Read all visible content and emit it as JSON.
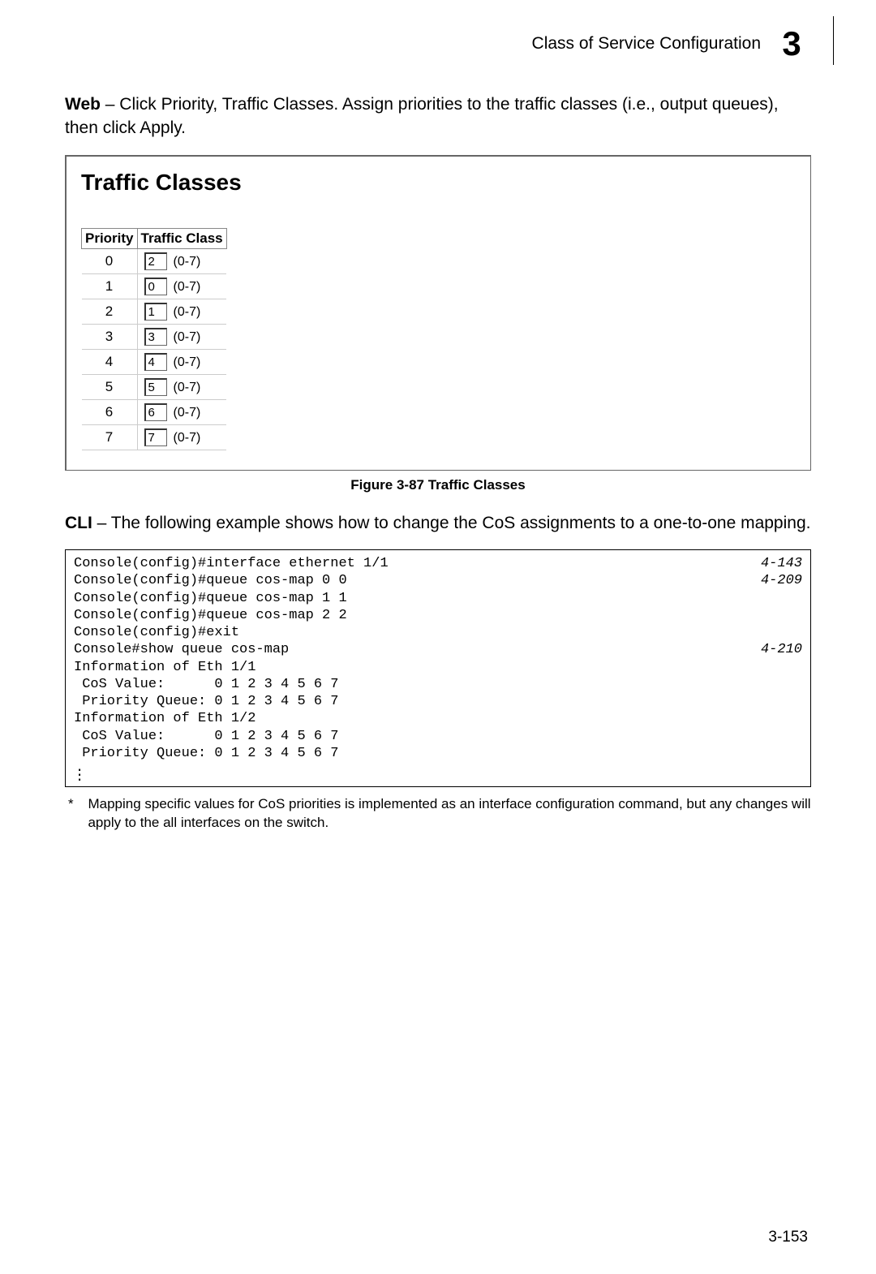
{
  "header": {
    "title": "Class of Service Configuration",
    "chapter": "3"
  },
  "intro": {
    "label": "Web",
    "text": " – Click Priority, Traffic Classes. Assign priorities to the traffic classes (i.e., output queues), then click Apply."
  },
  "figure": {
    "panel_title": "Traffic Classes",
    "columns": {
      "priority": "Priority",
      "traffic_class": "Traffic Class"
    },
    "range_hint": "(0-7)",
    "caption": "Figure 3-87   Traffic Classes"
  },
  "chart_data": {
    "type": "table",
    "title": "Traffic Classes",
    "columns": [
      "Priority",
      "Traffic Class"
    ],
    "rows": [
      {
        "priority": "0",
        "value": "2"
      },
      {
        "priority": "1",
        "value": "0"
      },
      {
        "priority": "2",
        "value": "1"
      },
      {
        "priority": "3",
        "value": "3"
      },
      {
        "priority": "4",
        "value": "4"
      },
      {
        "priority": "5",
        "value": "5"
      },
      {
        "priority": "6",
        "value": "6"
      },
      {
        "priority": "7",
        "value": "7"
      }
    ],
    "value_range": "(0-7)"
  },
  "cli_intro": {
    "label": "CLI",
    "text": " – The following example shows how to change the CoS assignments to a one-to-one mapping."
  },
  "cli": {
    "lines": [
      {
        "text": "Console(config)#interface ethernet 1/1",
        "ref": "4-143"
      },
      {
        "text": "Console(config)#queue cos-map 0 0",
        "ref": "4-209"
      },
      {
        "text": "Console(config)#queue cos-map 1 1",
        "ref": ""
      },
      {
        "text": "Console(config)#queue cos-map 2 2",
        "ref": ""
      },
      {
        "text": "Console(config)#exit",
        "ref": ""
      },
      {
        "text": "Console#show queue cos-map",
        "ref": "4-210"
      },
      {
        "text": "Information of Eth 1/1",
        "ref": ""
      },
      {
        "text": " CoS Value:      0 1 2 3 4 5 6 7",
        "ref": ""
      },
      {
        "text": " Priority Queue: 0 1 2 3 4 5 6 7",
        "ref": ""
      },
      {
        "text": "Information of Eth 1/2",
        "ref": ""
      },
      {
        "text": " CoS Value:      0 1 2 3 4 5 6 7",
        "ref": ""
      },
      {
        "text": " Priority Queue: 0 1 2 3 4 5 6 7",
        "ref": ""
      }
    ]
  },
  "footnote": {
    "marker": "*",
    "text": "Mapping specific values for CoS priorities is implemented as an interface configuration command, but any changes will apply to the all interfaces on the switch."
  },
  "page_number": "3-153"
}
